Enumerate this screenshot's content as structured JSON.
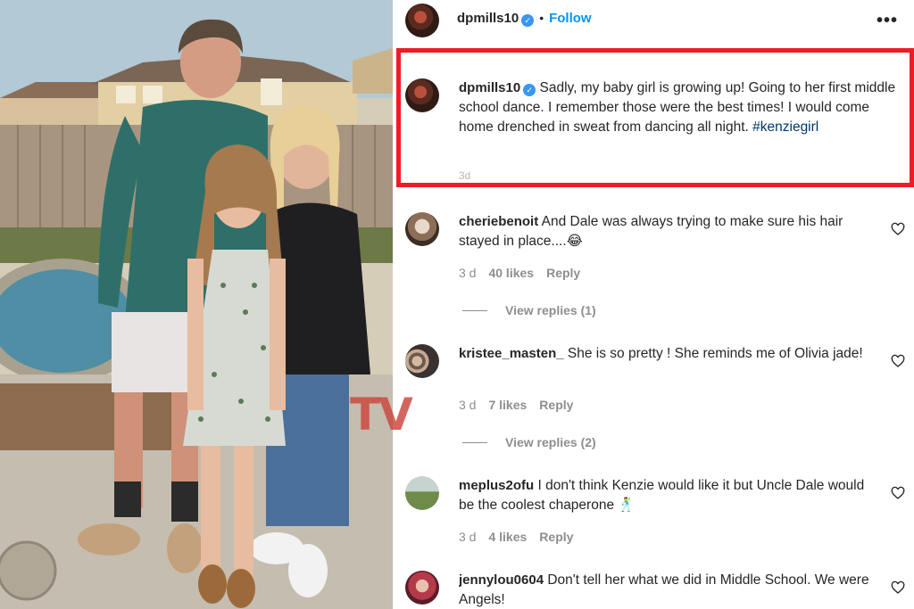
{
  "post": {
    "author": "dpmills10",
    "follow_label": "Follow",
    "separator": "•",
    "more_label": "•••",
    "caption": "Sadly, my baby girl is growing up! Going to her first middle school dance. I remember those were the best times! I would come home drenched in sweat from dancing all night.",
    "hashtag": "#kenziegirl",
    "time": "3d"
  },
  "comments": [
    {
      "username": "cheriebenoit",
      "text": "And Dale was always trying to make sure his hair stayed in place....😂",
      "time": "3 d",
      "likes": "40 likes",
      "reply": "Reply",
      "view_replies": "View replies (1)"
    },
    {
      "username": "kristee_masten_",
      "text": "She is so pretty ! She reminds me of Olivia jade!",
      "time": "3 d",
      "likes": "7 likes",
      "reply": "Reply",
      "view_replies": "View replies (2)"
    },
    {
      "username": "meplus2ofu",
      "text": "I don't think Kenzie would like it but Uncle Dale would be the coolest chaperone 🕺",
      "time": "3 d",
      "likes": "4 likes",
      "reply": "Reply"
    },
    {
      "username": "jennylou0604",
      "text": "Don't tell her what we did in Middle School. We were Angels!"
    }
  ],
  "watermark": "TV",
  "colors": {
    "highlight_border": "#ee1c25",
    "follow_blue": "#0095f6",
    "verified_blue": "#3897f0",
    "hashtag": "#00376b",
    "meta_gray": "#8e8e8e"
  },
  "icons": [
    "verified-badge-icon",
    "more-options-icon",
    "heart-icon"
  ]
}
